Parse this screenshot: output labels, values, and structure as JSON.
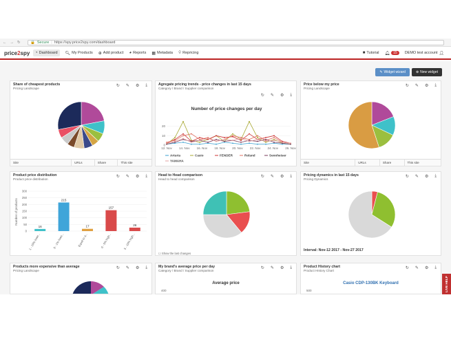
{
  "browser": {
    "secure": "Secure",
    "url": "https://spy.price2spy.com/dashboard"
  },
  "nav": {
    "logo_a": "price",
    "logo_b": "2",
    "logo_c": "spy",
    "items": [
      "Dashboard",
      "My Products",
      "Add product",
      "Reports",
      "Metadata",
      "Repricing"
    ],
    "tutorial": "Tutorial",
    "notif_count": "15",
    "account": "DEMO test account"
  },
  "actions": {
    "wizard": "Widget wizard",
    "new_widget": "New widget"
  },
  "widgets": {
    "w1": {
      "title": "Share of cheapest products",
      "sub": "Pricing Landscape",
      "foot": [
        "Site",
        "URLs",
        "Share",
        "This site"
      ]
    },
    "w2": {
      "title": "Agregate pricing trends - price changes in last 15 days",
      "sub": "Category / Brand / Supplier comparison"
    },
    "w3": {
      "title": "Price below my price",
      "sub": "Pricing Landscape",
      "foot": [
        "Site",
        "URLs",
        "Share",
        "This site"
      ]
    },
    "w4": {
      "title": "Product price distribution",
      "sub": "Product price distribution"
    },
    "w5": {
      "title": "Head to Head comparison",
      "sub": "Head to head comparison",
      "foot_note": "Show the last changes"
    },
    "w6": {
      "title": "Pricing dynamics in last 15 days",
      "sub": "Pricing Dynamics",
      "interval": "Interval: Nov-12 2017 - Nov-27 2017"
    },
    "w7": {
      "title": "Products more expensive than average",
      "sub": "Pricing Landscape"
    },
    "w8": {
      "title": "My brand's average price per day",
      "sub": "Category / Brand / Supplier comparison",
      "chart_title": "Average price",
      "ytick": "400"
    },
    "w9": {
      "title": "Product History chart",
      "sub": "Product History Chart",
      "chart_title": "Casio CDP-130BK Keyboard",
      "ytick": "500"
    }
  },
  "live_help": "LIVE HELP",
  "chart_data": [
    {
      "type": "pie",
      "title": "",
      "values": [
        22,
        9,
        6,
        5,
        6,
        7,
        5,
        6,
        6,
        28
      ],
      "colors": [
        "#b04a9a",
        "#3fc1c9",
        "#9bbf3f",
        "#d4a544",
        "#3b4a8a",
        "#e0c9a6",
        "#7a4a2a",
        "#c9c9c9",
        "#e94f64",
        "#1c2a5a"
      ]
    },
    {
      "type": "line",
      "title": "Number of price changes per day",
      "categories": [
        "12. Nov",
        "14. Nov",
        "16. Nov",
        "18. Nov",
        "20. Nov",
        "22. Nov",
        "24. Nov",
        "26. Nov"
      ],
      "ylim": [
        0,
        30
      ],
      "yticks": [
        "0",
        "10",
        "20"
      ],
      "series": [
        {
          "name": "Arturia",
          "color": "#3aa0d0",
          "values": [
            1,
            2,
            3,
            1,
            1,
            2,
            1,
            3,
            2,
            1,
            2,
            1,
            1,
            2,
            1,
            1
          ]
        },
        {
          "name": "Casio",
          "color": "#a8a832",
          "values": [
            1,
            8,
            25,
            5,
            3,
            6,
            10,
            4,
            12,
            6,
            25,
            8,
            3,
            6,
            2,
            1
          ]
        },
        {
          "name": "FENDER",
          "color": "#c33",
          "values": [
            2,
            6,
            12,
            4,
            8,
            6,
            10,
            8,
            9,
            5,
            12,
            6,
            8,
            10,
            4,
            2
          ]
        },
        {
          "name": "Roland",
          "color": "#e07060",
          "values": [
            3,
            5,
            10,
            12,
            6,
            8,
            4,
            6,
            10,
            8,
            6,
            10,
            5,
            8,
            3,
            2
          ]
        },
        {
          "name": "Sennheiser",
          "color": "#7a3a5a",
          "values": [
            1,
            3,
            6,
            4,
            5,
            3,
            6,
            4,
            5,
            3,
            5,
            4,
            6,
            3,
            2,
            1
          ]
        },
        {
          "name": "YAMAHA",
          "color": "#e0a0a0",
          "values": [
            2,
            4,
            7,
            3,
            5,
            7,
            4,
            6,
            5,
            7,
            4,
            6,
            4,
            5,
            3,
            2
          ]
        }
      ]
    },
    {
      "type": "pie",
      "title": "",
      "values": [
        19,
        13,
        13,
        55
      ],
      "colors": [
        "#b04a9a",
        "#3fc1c9",
        "#9bbf3f",
        "#d99c43"
      ]
    },
    {
      "type": "bar",
      "title": "",
      "ylabel": "Number of products",
      "categories": [
        "1 - 10% lowe...",
        "0 - 1% lowe...",
        "Equal to a...",
        "0 - 5% high...",
        "5 - 10% high..."
      ],
      "values": [
        16,
        215,
        17,
        157,
        26
      ],
      "colors": [
        "#3fc1c9",
        "#3fa5d9",
        "#e0a040",
        "#d94a4a",
        "#d94a4a"
      ],
      "ylim": [
        0,
        300
      ],
      "yticks": [
        "0",
        "50",
        "100",
        "150",
        "200",
        "250",
        "300"
      ]
    },
    {
      "type": "pie",
      "title": "",
      "values": [
        23,
        16,
        36,
        25
      ],
      "colors": [
        "#8fbf30",
        "#e94f4f",
        "#d9d9d9",
        "#3fc1b5"
      ]
    },
    {
      "type": "pie",
      "title": "",
      "values": [
        4,
        30,
        66
      ],
      "colors": [
        "#e94f4f",
        "#8fbf30",
        "#d9d9d9"
      ]
    }
  ]
}
